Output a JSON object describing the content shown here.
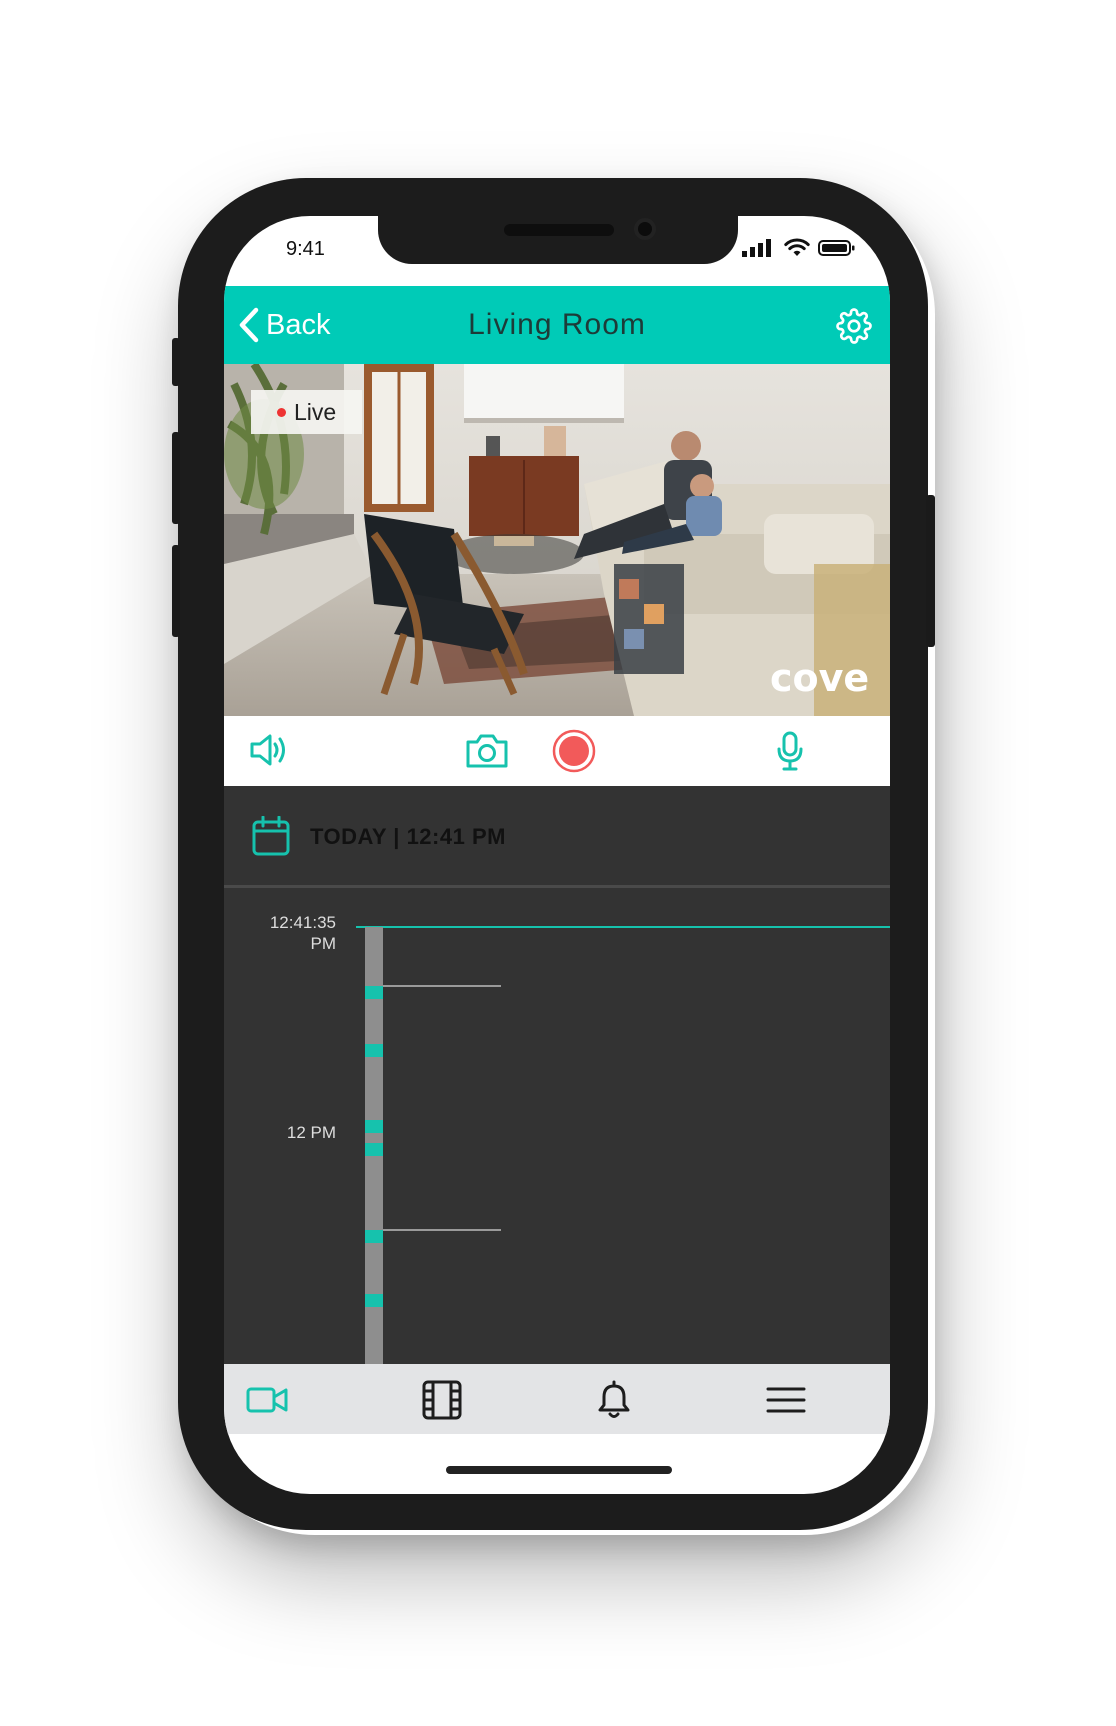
{
  "status_bar": {
    "time": "9:41",
    "icons": [
      "signal-icon",
      "wifi-icon",
      "battery-icon"
    ]
  },
  "header": {
    "back_label": "Back",
    "title": "Living Room",
    "settings_icon": "gear-icon"
  },
  "video": {
    "live_label": "Live",
    "brand_watermark": "cove"
  },
  "controls": {
    "items": [
      "speaker-icon",
      "camera-icon",
      "record-button",
      "microphone-icon"
    ]
  },
  "timeline": {
    "date_label": "TODAY | 12:41 PM",
    "current_time_label_line1": "12:41:35",
    "current_time_label_line2": "PM",
    "hour_label": "12 PM"
  },
  "tabbar": {
    "items": [
      "video-camera-icon",
      "film-icon",
      "bell-icon",
      "menu-icon"
    ],
    "active": "video-camera-icon"
  },
  "colors": {
    "accent": "#00cbb7",
    "record": "#f25a5a",
    "timeline_bg": "#333333",
    "tabbar_bg": "#e3e4e6"
  }
}
